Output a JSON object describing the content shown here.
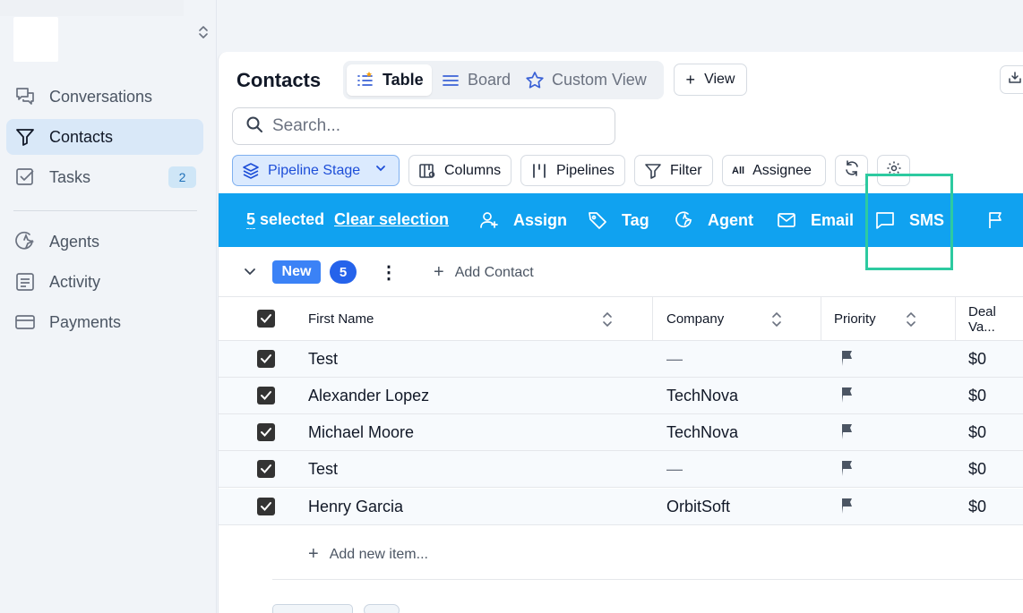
{
  "sidebar": {
    "items": [
      {
        "label": "Conversations",
        "icon": "chat-bubbles-icon"
      },
      {
        "label": "Contacts",
        "icon": "funnel-icon"
      },
      {
        "label": "Tasks",
        "icon": "checkbox-icon",
        "badge": "2"
      },
      {
        "label": "Agents",
        "icon": "sparkle-agent-icon"
      },
      {
        "label": "Activity",
        "icon": "activity-list-icon"
      },
      {
        "label": "Payments",
        "icon": "card-icon"
      }
    ]
  },
  "header": {
    "title": "Contacts",
    "tabs": [
      {
        "label": "Table",
        "icon": "list-icon",
        "active": true
      },
      {
        "label": "Board",
        "icon": "board-lines-icon",
        "active": false
      },
      {
        "label": "Custom View",
        "icon": "star-icon",
        "active": false
      }
    ],
    "add_view_label": "View"
  },
  "search": {
    "placeholder": "Search..."
  },
  "filters": {
    "pipeline_stage": "Pipeline Stage",
    "columns": "Columns",
    "pipelines": "Pipelines",
    "filter": "Filter",
    "assignee_chip": "All",
    "assignee": "Assignee"
  },
  "selection": {
    "count": "5",
    "selected_label": "selected",
    "clear_label": "Clear selection",
    "actions": {
      "assign": "Assign",
      "tag": "Tag",
      "agent": "Agent",
      "email": "Email",
      "sms": "SMS"
    }
  },
  "group": {
    "name": "New",
    "count": "5",
    "add_contact": "Add Contact"
  },
  "table": {
    "columns": {
      "first_name": "First Name",
      "company": "Company",
      "priority": "Priority",
      "deal_value": "Deal Va..."
    },
    "rows": [
      {
        "first_name": "Test",
        "company": "—",
        "deal_value": "$0"
      },
      {
        "first_name": "Alexander Lopez",
        "company": "TechNova",
        "deal_value": "$0"
      },
      {
        "first_name": "Michael Moore",
        "company": "TechNova",
        "deal_value": "$0"
      },
      {
        "first_name": "Test",
        "company": "—",
        "deal_value": "$0"
      },
      {
        "first_name": "Henry Garcia",
        "company": "OrbitSoft",
        "deal_value": "$0"
      }
    ],
    "add_item": "Add new item..."
  },
  "colors": {
    "accent": "#10a2f0",
    "highlight": "#2dcaa0",
    "group_tag": "#3b82f6"
  }
}
